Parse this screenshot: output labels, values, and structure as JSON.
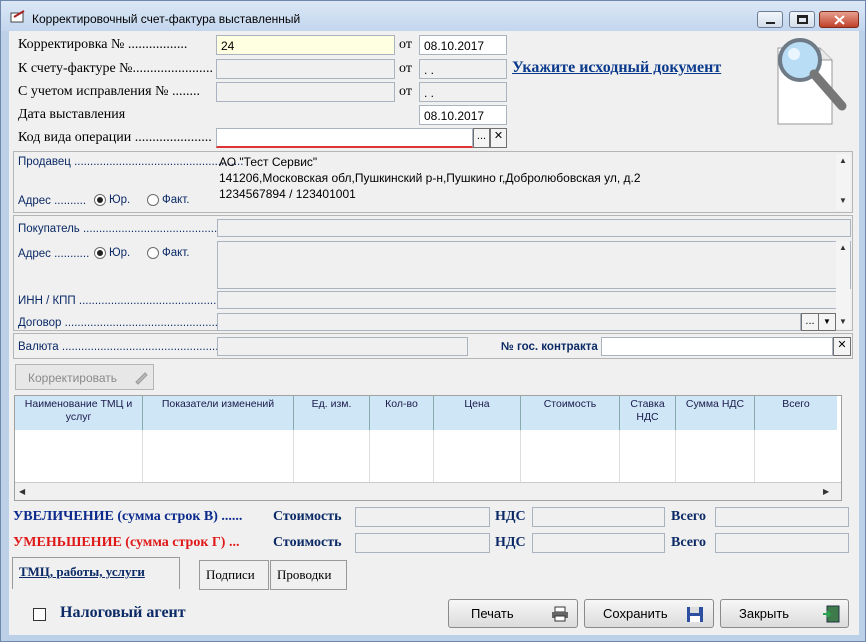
{
  "window": {
    "title": "Корректировочный счет-фактура выставленный"
  },
  "header": {
    "correction_label": "Корректировка № .................",
    "correction_number": "24",
    "from1": "от",
    "correction_date": "08.10.2017",
    "invoice_label": "К счету-фактуре №.......................",
    "invoice_number": "",
    "from2": "от",
    "invoice_date": " .  .",
    "fix_label": "С учетом исправления  № ........",
    "fix_number": "",
    "from3": "от",
    "fix_date": " .  .",
    "issue_label": "Дата выставления",
    "issue_date": "08.10.2017",
    "op_label": "Код вида операции ......................",
    "op_value": "",
    "source_link": "Укажите исходный документ"
  },
  "seller": {
    "label": "Продавец .....................................................",
    "lines": [
      "АО \"Тест Сервис\"",
      "141206,Московская обл,Пушкинский р-н,Пушкино г,Добролюбовская ул, д.2",
      "1234567894 / 123401001"
    ],
    "address_label": "Адрес ..........",
    "radio_legal": "Юр.",
    "radio_fact": "Факт."
  },
  "buyer": {
    "label": "Покупатель ......................................................",
    "address_label": "Адрес ...........",
    "radio_legal": "Юр.",
    "radio_fact": "Факт.",
    "inn_label": "ИНН / КПП ......................................................",
    "contract_label": "Договор ..........................................................."
  },
  "currency": {
    "label": "Валюта ...............................................................",
    "contract_label": "№ гос. контракта"
  },
  "toolbar": {
    "adjust_button": "Корректировать"
  },
  "table": {
    "columns": [
      "Наименование ТМЦ и услуг",
      "Показатели изменений",
      "Ед. изм.",
      "Кол-во",
      "Цена",
      "Стоимость",
      "Ставка НДС",
      "Сумма НДС",
      "Всего"
    ]
  },
  "totals": {
    "increase_label": "УВЕЛИЧЕНИЕ (сумма строк В) ......",
    "decrease_label": "УМЕНЬШЕНИЕ (сумма строк Г) ...",
    "cost": "Стоимость",
    "vat": "НДС",
    "total": "Всего"
  },
  "tabs": [
    "ТМЦ, работы, услуги",
    "Подписи",
    "Проводки"
  ],
  "footer": {
    "tax_agent": "Налоговый агент",
    "print": "Печать",
    "save": "Сохранить",
    "close": "Закрыть"
  },
  "colors": {
    "link": "#0b3a8c",
    "increase": "#0b2a8c",
    "decrease": "#e01818",
    "header_bg": "#cfe6f7"
  }
}
